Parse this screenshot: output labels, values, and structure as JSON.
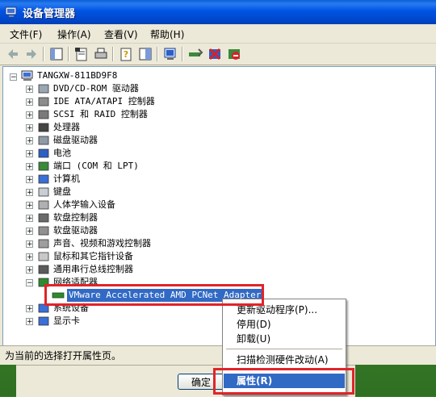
{
  "window": {
    "title": "设备管理器"
  },
  "menubar": [
    {
      "label": "文件(F)"
    },
    {
      "label": "操作(A)"
    },
    {
      "label": "查看(V)"
    },
    {
      "label": "帮助(H)"
    }
  ],
  "toolbar": {
    "icons": [
      "back-arrow-icon",
      "forward-arrow-icon",
      "console-tree-icon",
      "properties-icon",
      "print-icon",
      "help-icon",
      "show-hide-icon",
      "scan-hardware-icon",
      "update-driver-icon",
      "uninstall-icon",
      "disable-icon"
    ]
  },
  "tree": {
    "root": "TANGXW-811BD9F8",
    "items": [
      {
        "label": "DVD/CD-ROM 驱动器",
        "icon": "cdrom-icon",
        "expanded": false
      },
      {
        "label": "IDE ATA/ATAPI 控制器",
        "icon": "ide-controller-icon",
        "expanded": false
      },
      {
        "label": "SCSI 和 RAID 控制器",
        "icon": "scsi-controller-icon",
        "expanded": false
      },
      {
        "label": "处理器",
        "icon": "processor-icon",
        "expanded": false
      },
      {
        "label": "磁盘驱动器",
        "icon": "disk-drive-icon",
        "expanded": false
      },
      {
        "label": "电池",
        "icon": "battery-icon",
        "expanded": false
      },
      {
        "label": "端口 (COM 和 LPT)",
        "icon": "port-icon",
        "expanded": false
      },
      {
        "label": "计算机",
        "icon": "computer-icon",
        "expanded": false
      },
      {
        "label": "键盘",
        "icon": "keyboard-icon",
        "expanded": false
      },
      {
        "label": "人体学输入设备",
        "icon": "hid-icon",
        "expanded": false
      },
      {
        "label": "软盘控制器",
        "icon": "floppy-controller-icon",
        "expanded": false
      },
      {
        "label": "软盘驱动器",
        "icon": "floppy-drive-icon",
        "expanded": false
      },
      {
        "label": "声音、视频和游戏控制器",
        "icon": "sound-icon",
        "expanded": false
      },
      {
        "label": "鼠标和其它指针设备",
        "icon": "mouse-icon",
        "expanded": false
      },
      {
        "label": "通用串行总线控制器",
        "icon": "usb-icon",
        "expanded": false
      },
      {
        "label": "网络适配器",
        "icon": "network-adapter-icon",
        "expanded": true
      },
      {
        "label": "系统设备",
        "icon": "system-device-icon",
        "expanded": false
      },
      {
        "label": "显示卡",
        "icon": "display-adapter-icon",
        "expanded": false
      }
    ],
    "selected_child": {
      "label": "VMware Accelerated AMD PCNet Adapter",
      "icon": "network-card-icon"
    }
  },
  "status": {
    "text": "为当前的选择打开属性页。"
  },
  "context_menu": {
    "items": [
      {
        "label": "更新驱动程序(P)..."
      },
      {
        "label": "停用(D)"
      },
      {
        "label": "卸载(U)"
      },
      {
        "label": "扫描检测硬件改动(A)"
      },
      {
        "label": "属性(R)"
      }
    ]
  },
  "dialog": {
    "ok_label": "确定"
  },
  "colors": {
    "titlebar": "#0054e3",
    "selection": "#316ac5",
    "highlight_box": "#e0242a",
    "window_bg": "#ece9d8"
  }
}
